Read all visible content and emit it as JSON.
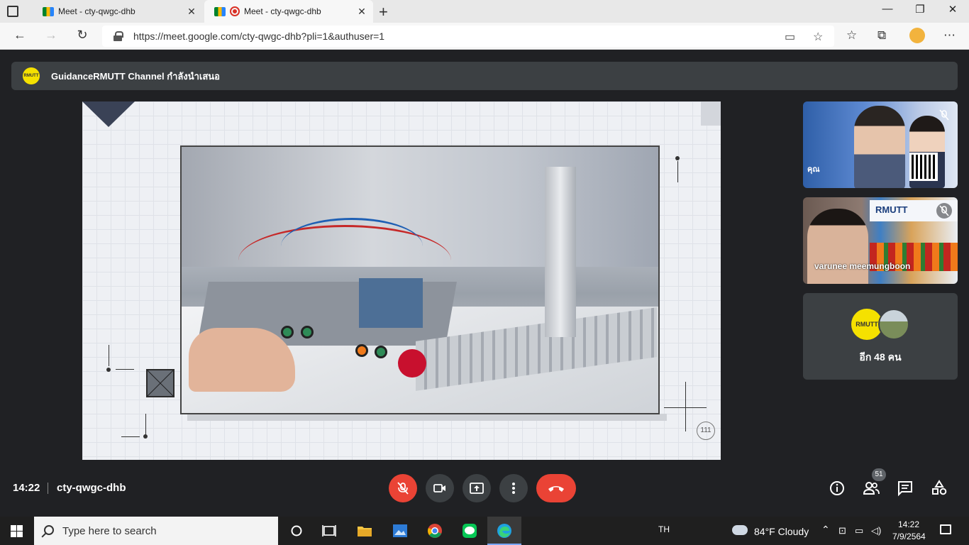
{
  "browser": {
    "tabs": [
      {
        "title": "Meet - cty-qwgc-dhb",
        "active": false
      },
      {
        "title": "Meet - cty-qwgc-dhb",
        "active": true
      }
    ],
    "url": "https://meet.google.com/cty-qwgc-dhb?pli=1&authuser=1"
  },
  "meet": {
    "presenter_banner": "GuidanceRMUTT Channel กำลังนำเสนอ",
    "banner_logo_text": "RMUTT",
    "participants": [
      {
        "name": "คุณ",
        "muted": true
      },
      {
        "name": "varunee meemungboon",
        "muted": true
      }
    ],
    "others": {
      "avatar_text": "RMUTT",
      "label": "อีก 48 คน"
    },
    "screen_slide_number": "111",
    "bottom": {
      "time": "14:22",
      "meeting_code": "cty-qwgc-dhb",
      "people_count": "51"
    },
    "colors": {
      "end_call": "#ea4335",
      "mic_off": "#ea4335"
    }
  },
  "taskbar": {
    "search_placeholder": "Type here to search",
    "language": "TH",
    "weather": "84°F  Cloudy",
    "clock_time": "14:22",
    "clock_date": "7/9/2564"
  }
}
